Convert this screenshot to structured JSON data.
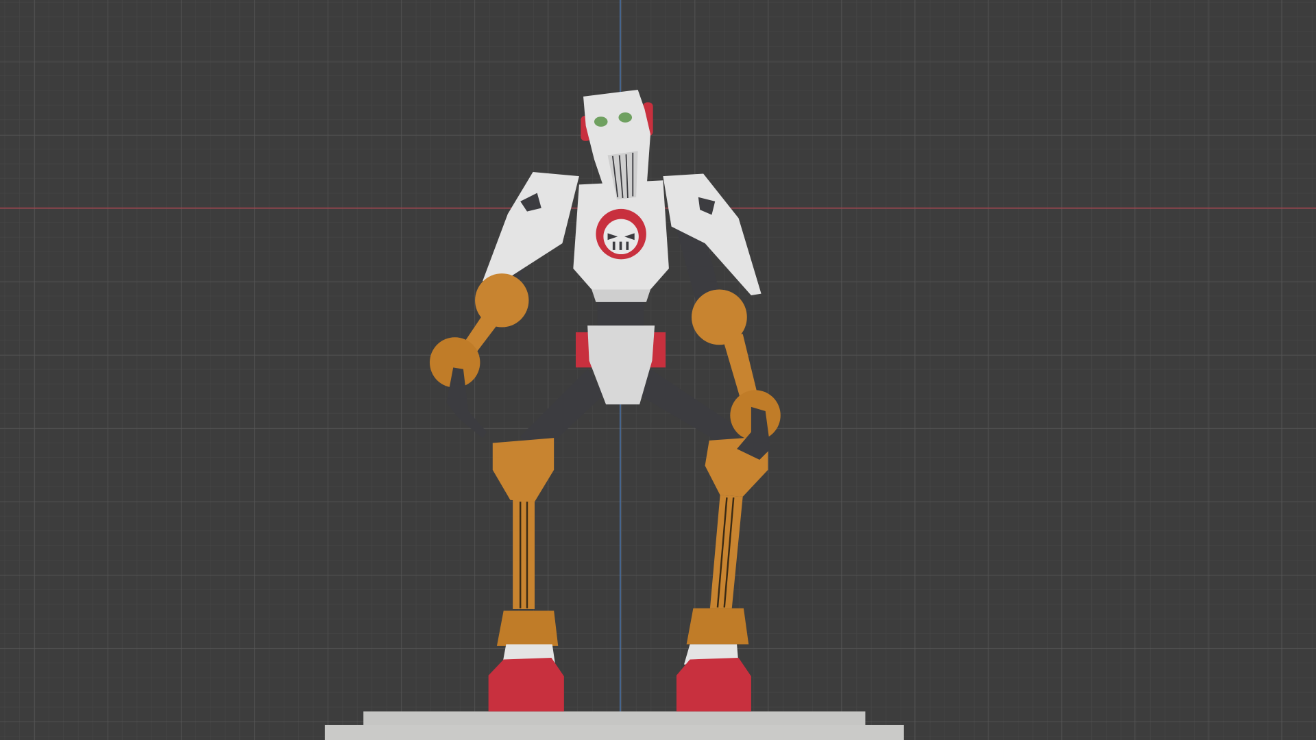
{
  "viewport": {
    "name": "3D Viewport",
    "colors": {
      "background": "#3d3d3d",
      "grid_minor": "#474747",
      "grid_major": "#555555",
      "x_axis": "#b0404c",
      "z_axis": "#4a78b4"
    }
  },
  "model": {
    "name": "robot",
    "colors": {
      "white": "#e4e4e4",
      "shade": "#b8b8b8",
      "dark": "#3c3c40",
      "orange": "#c88430",
      "orange_dark": "#a86a22",
      "red": "#c8303e",
      "pedestal": "#c8c8c6"
    }
  }
}
